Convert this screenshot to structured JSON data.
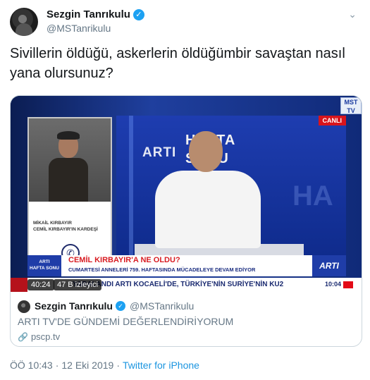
{
  "tweet": {
    "author_name": "Sezgin Tanrıkulu",
    "author_handle": "@MSTanrikulu",
    "verified_glyph": "✓",
    "more_glyph": "⌄",
    "text": "Sivillerin öldüğü, askerlerin öldüğümbir savaştan nasıl\nyana olursunuz?"
  },
  "video": {
    "live_badge": "CANLI",
    "channel_logo": "MST TV",
    "studio_arti": "ARTI",
    "studio_hafta": "HAFTA",
    "studio_sonu": "SONU",
    "studio_bg_letter": "HA",
    "guest_name": "MİKAİL KIRBAYIR",
    "guest_title": "CEMİL KIRBAYIR'IN KARDEŞİ",
    "phone_icon": "✆",
    "lower_left_1": "ARTI",
    "lower_left_2": "HAFTA SONU",
    "headline": "CEMİL KIRBAYIR'A NE OLDU?",
    "subheadline": "CUMARTESİ ANNELERİ 759. HAFTASINDA MÜCADELEYE DEVAM EDİYOR",
    "lower_right_logo": "ARTI",
    "ticker": "YARALANDI   ARTI   KOCAELİ'DE, TÜRKİYE'NİN SURİYE'NİN KU2",
    "ticker_time": "10:04",
    "duration": "40:24",
    "viewers": "47 B izleyici"
  },
  "card": {
    "author_name": "Sezgin Tanrıkulu",
    "author_handle": "@MSTanrikulu",
    "text": "ARTI TV'DE GÜNDEMİ DEĞERLENDİRİYORUM",
    "link_icon": "🔗",
    "link": "pscp.tv"
  },
  "meta": {
    "time": "ÖÖ 10:43",
    "separator1": "·",
    "date": "12 Eki 2019",
    "separator2": "·",
    "source": "Twitter for iPhone"
  },
  "colors": {
    "accent": "#1da1f2",
    "link": "#1b95e0",
    "live_red": "#d8141c",
    "studio_blue": "#1e3db0"
  }
}
